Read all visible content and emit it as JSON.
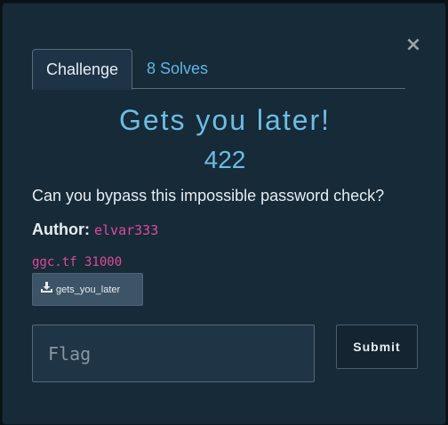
{
  "modal": {
    "close_glyph": "×",
    "tabs": [
      {
        "label": "Challenge",
        "active": true
      },
      {
        "label": "8 Solves",
        "active": false
      }
    ],
    "title": "Gets you later!",
    "points": "422",
    "description": "Can you bypass this impossible password check?",
    "author": {
      "label": "Author:",
      "name": "elvar333"
    },
    "connection": "ggc.tf 31000",
    "file": {
      "icon": "download-icon",
      "label": "gets_you_later"
    },
    "flag_input": {
      "placeholder": "Flag",
      "value": ""
    },
    "submit_label": "Submit"
  },
  "colors": {
    "accent": "#6cbde6",
    "link": "#5fb5e4",
    "code": "#e0499c",
    "background": "#172a38"
  }
}
